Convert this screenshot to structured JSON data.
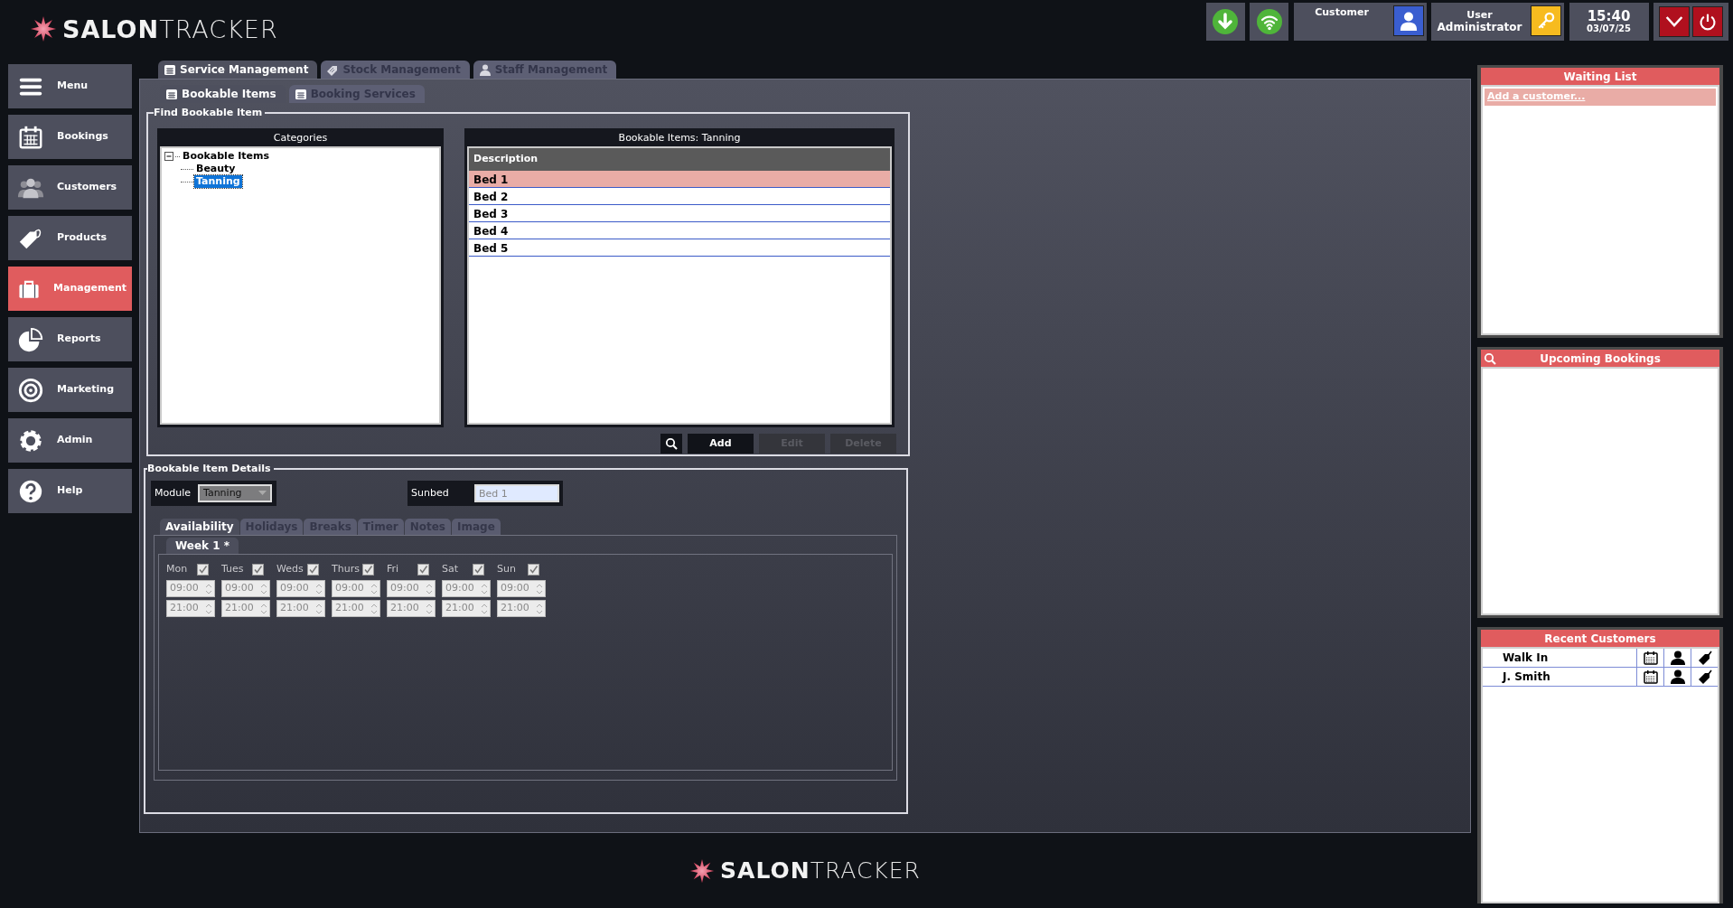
{
  "header_logo": {
    "bold": "SALON",
    "light": "TRACKER"
  },
  "toolbar": {
    "customer": {
      "label": "Customer"
    },
    "user": {
      "label": "User",
      "name": "Administrator"
    },
    "clock": {
      "time": "15:40",
      "date": "03/07/25"
    }
  },
  "sidebar": [
    {
      "label": "Menu",
      "selected": false
    },
    {
      "label": "Bookings",
      "selected": false
    },
    {
      "label": "Customers",
      "selected": false
    },
    {
      "label": "Products",
      "selected": false
    },
    {
      "label": "Management",
      "selected": true
    },
    {
      "label": "Reports",
      "selected": false
    },
    {
      "label": "Marketing",
      "selected": false
    },
    {
      "label": "Admin",
      "selected": false
    },
    {
      "label": "Help",
      "selected": false
    }
  ],
  "tabs": [
    {
      "label": "Service Management",
      "selected": true
    },
    {
      "label": "Stock Management",
      "selected": false
    },
    {
      "label": "Staff Management",
      "selected": false
    }
  ],
  "subtabs": [
    {
      "label": "Bookable Items",
      "selected": true
    },
    {
      "label": "Booking Services",
      "selected": false
    }
  ],
  "find_group": {
    "title": "Find Bookable Item",
    "categories": {
      "title": "Categories",
      "tree": [
        {
          "label": "Bookable Items",
          "expanded": true,
          "selected": false,
          "children": [
            {
              "label": "Beauty",
              "selected": false
            },
            {
              "label": "Tanning",
              "selected": true
            }
          ]
        }
      ]
    },
    "items_list": {
      "title": "Bookable Items: Tanning",
      "column": "Description",
      "rows": [
        {
          "label": "Bed 1",
          "selected": true
        },
        {
          "label": "Bed 2",
          "selected": false
        },
        {
          "label": "Bed 3",
          "selected": false
        },
        {
          "label": "Bed 4",
          "selected": false
        },
        {
          "label": "Bed 5",
          "selected": false
        }
      ]
    },
    "buttons": [
      {
        "label": "Add",
        "disabled": false
      },
      {
        "label": "Edit",
        "disabled": true
      },
      {
        "label": "Delete",
        "disabled": true
      }
    ]
  },
  "details": {
    "title": "Bookable Item Details",
    "module": {
      "label": "Module",
      "value": "Tanning"
    },
    "sunbed": {
      "label": "Sunbed",
      "value": "Bed 1"
    },
    "tabs": [
      {
        "label": "Availability",
        "selected": true
      },
      {
        "label": "Holidays",
        "selected": false
      },
      {
        "label": "Breaks",
        "selected": false
      },
      {
        "label": "Timer",
        "selected": false
      },
      {
        "label": "Notes",
        "selected": false
      },
      {
        "label": "Image",
        "selected": false
      }
    ],
    "week_tabs": [
      {
        "label": "Week 1 *",
        "selected": true
      }
    ],
    "days": [
      {
        "label": "Mon",
        "checked": true,
        "start": "09:00",
        "end": "21:00"
      },
      {
        "label": "Tues",
        "checked": true,
        "start": "09:00",
        "end": "21:00"
      },
      {
        "label": "Weds",
        "checked": true,
        "start": "09:00",
        "end": "21:00"
      },
      {
        "label": "Thurs",
        "checked": true,
        "start": "09:00",
        "end": "21:00"
      },
      {
        "label": "Fri",
        "checked": true,
        "start": "09:00",
        "end": "21:00"
      },
      {
        "label": "Sat",
        "checked": true,
        "start": "09:00",
        "end": "21:00"
      },
      {
        "label": "Sun",
        "checked": true,
        "start": "09:00",
        "end": "21:00"
      }
    ]
  },
  "footer_logo": {
    "bold": "SALON",
    "light": "TRACKER"
  },
  "waiting_list": {
    "title": "Waiting List",
    "link": "Add a customer..."
  },
  "upcoming": {
    "title": "Upcoming Bookings"
  },
  "recent": {
    "title": "Recent Customers",
    "rows": [
      {
        "name": "Walk In"
      },
      {
        "name": "J. Smith"
      }
    ]
  }
}
